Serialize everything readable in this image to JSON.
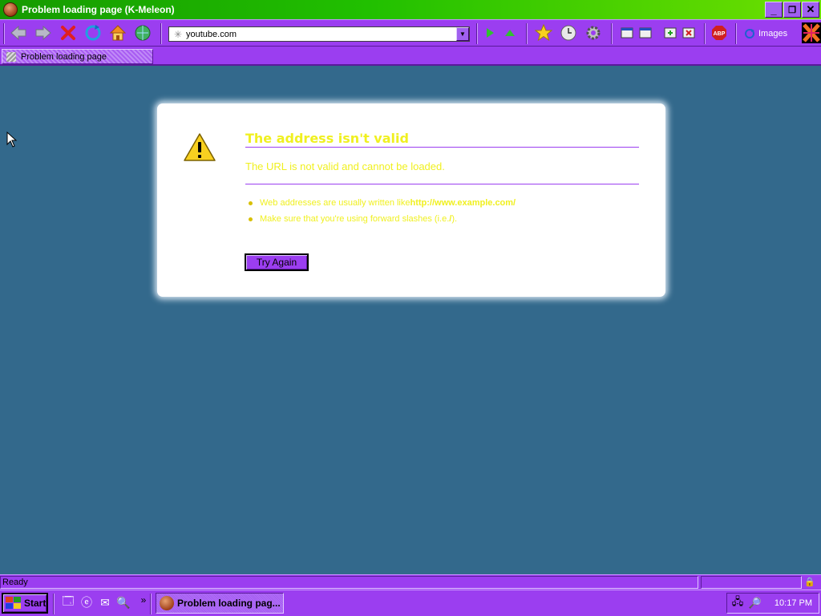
{
  "window": {
    "title": "Problem loading page (K-Meleon)",
    "controls": {
      "minimize": "_",
      "restore": "❐",
      "close": "✕"
    }
  },
  "toolbar": {
    "url_value": "youtube.com",
    "images_label": "Images",
    "buttons": [
      "back-icon",
      "forward-icon",
      "stop-icon",
      "reload-icon",
      "home-icon",
      "globe-icon",
      "go-icon",
      "up-icon",
      "bookmarks-star-icon",
      "history-icon",
      "settings-icon",
      "window-icon",
      "window-icon",
      "new-tab-icon",
      "close-tab-icon",
      "adblock-icon",
      "images-icon",
      "kmeleon-logo-icon"
    ],
    "adblock_label": "ABP"
  },
  "tab": {
    "label": "Problem loading page"
  },
  "error": {
    "title": "The address isn't valid",
    "short_desc": "The URL is not valid and cannot be loaded.",
    "hints": [
      {
        "text": "Web addresses are usually written like ",
        "bold": "http://www.example.com/"
      },
      {
        "text": "Make sure that you're using forward slashes (i.e. ",
        "bold": "/",
        "tail": ")."
      }
    ],
    "button_label": "Try Again"
  },
  "status": {
    "text": "Ready"
  },
  "taskbar": {
    "start_label": "Start",
    "task_label": "Problem loading pag...",
    "more_label": "»",
    "clock": "10:17 PM"
  },
  "colors": {
    "accent": "#9b3ef0",
    "content_bg": "#33698c",
    "error_text": "#f0f020",
    "titlebar": "#21c000"
  }
}
